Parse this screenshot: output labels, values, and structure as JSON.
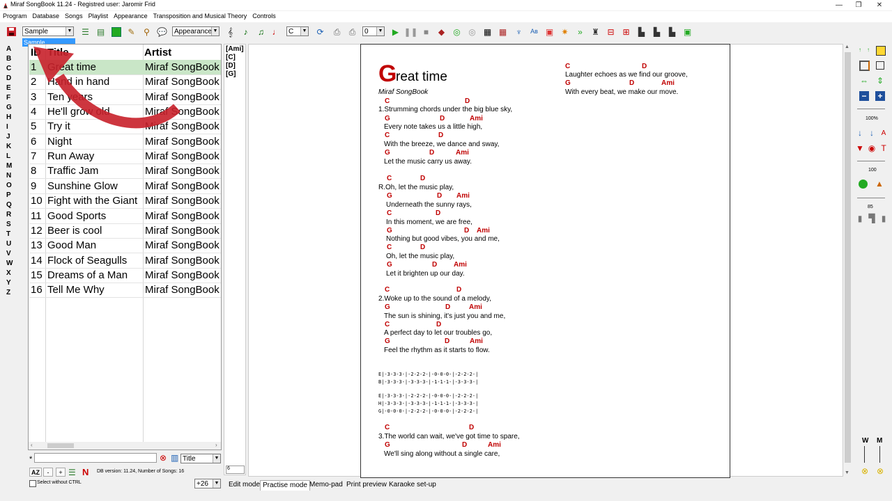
{
  "window": {
    "title": "Miraf SongBook 11.24 - Registred user: Jaromir Frid",
    "minimize": "—",
    "restore": "❐",
    "close": "✕"
  },
  "menu": [
    "Program",
    "Database",
    "Songs",
    "Playlist",
    "Appearance",
    "Transposition and Musical Theory",
    "Controls"
  ],
  "toolbar": {
    "database_select": "Sample",
    "database_tooltip": "Sample",
    "appearance_select": "Appearance:",
    "key_select": "C",
    "capo_select": "0"
  },
  "letters": [
    "A",
    "B",
    "C",
    "D",
    "E",
    "F",
    "G",
    "H",
    "I",
    "J",
    "K",
    "L",
    "M",
    "N",
    "O",
    "P",
    "Q",
    "R",
    "S",
    "T",
    "U",
    "V",
    "W",
    "X",
    "Y",
    "Z"
  ],
  "songlist": {
    "headers": {
      "id": "ID",
      "title": "Title",
      "artist": "Artist"
    },
    "rows": [
      {
        "id": "1",
        "title": "Great time",
        "artist": "Miraf SongBook"
      },
      {
        "id": "2",
        "title": "Hand in hand",
        "artist": "Miraf SongBook"
      },
      {
        "id": "3",
        "title": "Ten years",
        "artist": "Miraf SongBook"
      },
      {
        "id": "4",
        "title": "He'll grow old",
        "artist": "Miraf SongBook"
      },
      {
        "id": "5",
        "title": "Try it",
        "artist": "Miraf SongBook"
      },
      {
        "id": "6",
        "title": "Night",
        "artist": "Miraf SongBook"
      },
      {
        "id": "7",
        "title": "Run Away",
        "artist": "Miraf SongBook"
      },
      {
        "id": "8",
        "title": "Traffic Jam",
        "artist": "Miraf SongBook"
      },
      {
        "id": "9",
        "title": "Sunshine Glow",
        "artist": "Miraf SongBook"
      },
      {
        "id": "10",
        "title": "Fight with the Giant",
        "artist": "Miraf SongBook"
      },
      {
        "id": "11",
        "title": "Good Sports",
        "artist": "Miraf SongBook"
      },
      {
        "id": "12",
        "title": "Beer is cool",
        "artist": "Miraf SongBook"
      },
      {
        "id": "13",
        "title": "Good Man",
        "artist": "Miraf SongBook"
      },
      {
        "id": "14",
        "title": "Flock of Seagulls",
        "artist": "Miraf SongBook"
      },
      {
        "id": "15",
        "title": "Dreams of a Man",
        "artist": "Miraf SongBook"
      },
      {
        "id": "16",
        "title": "Tell Me Why",
        "artist": "Miraf SongBook"
      }
    ],
    "selected_index": 0
  },
  "chord_list": [
    "[Ami]",
    "[C]",
    "[D]",
    "[G]"
  ],
  "chord_input": "6",
  "search": {
    "prefix": "*",
    "value": "",
    "field_select": "Title"
  },
  "status": {
    "sort_label": "AZ",
    "minus": "-",
    "plus": "+",
    "db_info": "DB version: 11.24, Number of Songs: 16",
    "select_without_ctrl": "Select without CTRL",
    "transpose_select": "+26"
  },
  "tabs": [
    "Edit mode",
    "Practise mode",
    "Memo-pad",
    "Print preview",
    "Karaoke set-up"
  ],
  "active_tab": 1,
  "right_panel": {
    "zoom": "100%",
    "speed": "100",
    "scroll": "85",
    "w_label": "W",
    "m_label": "M"
  },
  "song": {
    "title_first": "G",
    "title_rest": "reat time",
    "artist": "Miraf SongBook",
    "chords": {
      "c": "C",
      "d": "D",
      "g": "G",
      "ami": "Ami"
    },
    "verse1": [
      "1.Strumming chords under the big blue sky,",
      "Every note takes us a little high,",
      "With the breeze, we dance and sway,",
      "Let the music carry us away."
    ],
    "refrain": [
      "R.Oh, let the music play,",
      "Underneath the sunny rays,",
      "In this moment, we are free,",
      "Nothing but good vibes, you and me,",
      "Oh, let the music play,",
      "Let it brighten up our day."
    ],
    "verse2": [
      "2.Woke up to the sound of a melody,",
      "The sun is shining, it's just you and me,",
      "A perfect day to let our troubles go,",
      "Feel the rhythm as it starts to flow."
    ],
    "tab1": [
      "E|-3-3-3-|-2-2-2-|-0-0-0-|-2-2-2-|",
      "B|-3-3-3-|-3-3-3-|-1-1-1-|-3-3-3-|"
    ],
    "tab2": [
      "E|-3-3-3-|-2-2-2-|-0-0-0-|-2-2-2-|",
      "H|-3-3-3-|-3-3-3-|-1-1-1-|-3-3-3-|",
      "G|-0-0-0-|-2-2-2-|-0-0-0-|-2-2-2-|"
    ],
    "verse3": [
      "3.The world can wait, we've got time to spare,",
      "We'll sing along without a single care,"
    ],
    "col2": [
      "Laughter echoes as we find our groove,",
      "With every beat, we make our move."
    ]
  },
  "colors": {
    "chord": "#c00000",
    "selected_row": "#c9e6c7",
    "arrow": "#c8202a"
  }
}
